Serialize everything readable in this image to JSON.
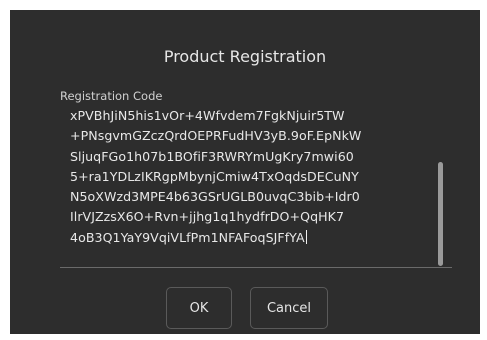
{
  "dialog": {
    "title": "Product Registration",
    "field_label": "Registration Code",
    "code_lines": [
      "xPVBhJiN5his1vOr+4Wfvdem7FgkNjuir5TW",
      "+PNsgvmGZczQrdOEPRFudHV3yB.9oF.EpNkW",
      "SljuqFGo1h07b1BOfiF3RWRYmUgKry7mwi60",
      "5+ra1YDLzIKRgpMbynjCmiw4TxOqdsDECuNY",
      "N5oXWzd3MPE4b63GSrUGLB0uvqC3bib+Idr0",
      "IlrVJZzsX6O+Rvn+jjhg1q1hydfrDO+QqHK7",
      "4oB3Q1YaY9VqiVLfPm1NFAFoqSJFfYA"
    ],
    "ok_label": "OK",
    "cancel_label": "Cancel"
  },
  "colors": {
    "dialog_background": "#2d2d2d",
    "text": "#e6e6e6",
    "button_border": "#5a5a5a"
  }
}
